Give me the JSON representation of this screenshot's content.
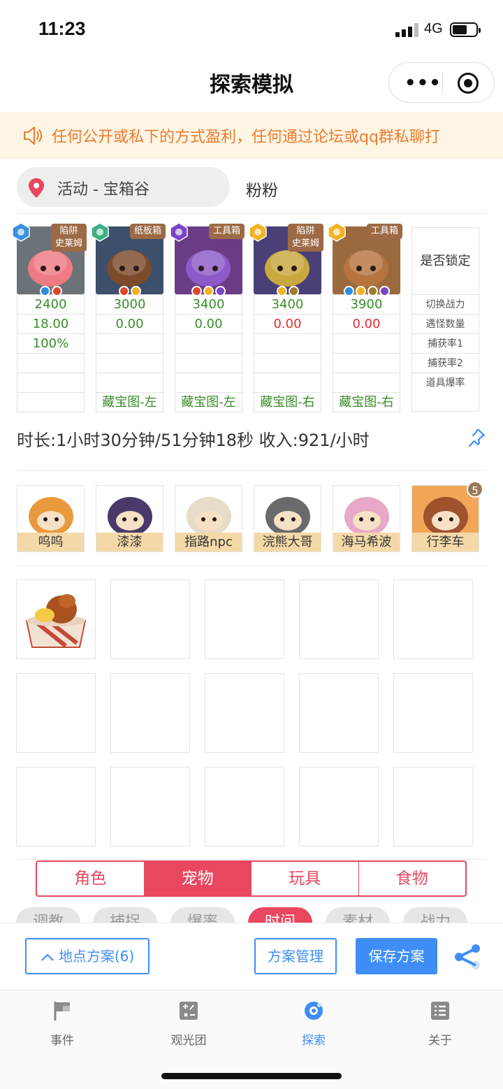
{
  "status_bar": {
    "time": "11:23",
    "network": "4G"
  },
  "nav": {
    "title": "探索模拟"
  },
  "notice": {
    "text": "任何公开或私下的方式盈利，任何通过论坛或qq群私聊打"
  },
  "location": {
    "label": "活动 - 宝箱谷",
    "user": "粉粉"
  },
  "pets": [
    {
      "tag": "陷阱\n史莱姆",
      "elem_color": "#3b8fe0",
      "bg": "#6b7278",
      "body": "#ee7b84",
      "minis": [
        "#2d8be0",
        "#e0452d"
      ],
      "cells": [
        {
          "v": "2400",
          "c": "g"
        },
        {
          "v": "18.00",
          "c": "g"
        },
        {
          "v": "100%",
          "c": "g"
        },
        {
          "v": "",
          "c": ""
        },
        {
          "v": "",
          "c": ""
        },
        {
          "v": "",
          "c": ""
        }
      ]
    },
    {
      "tag": "纸板箱",
      "elem_color": "#3cb084",
      "bg": "#3c4f6b",
      "body": "#7c4b2a",
      "minis": [
        "#e0452d",
        "#f2b223"
      ],
      "cells": [
        {
          "v": "3000",
          "c": "g"
        },
        {
          "v": "0.00",
          "c": "g"
        },
        {
          "v": "",
          "c": ""
        },
        {
          "v": "",
          "c": ""
        },
        {
          "v": "",
          "c": ""
        },
        {
          "v": "藏宝图-左",
          "c": "g"
        }
      ]
    },
    {
      "tag": "工具箱",
      "elem_color": "#7a45c8",
      "bg": "#6a3c86",
      "body": "#8c5bc9",
      "minis": [
        "#e0452d",
        "#f2b223",
        "#7a45c8"
      ],
      "cells": [
        {
          "v": "3400",
          "c": "g"
        },
        {
          "v": "0.00",
          "c": "g"
        },
        {
          "v": "",
          "c": ""
        },
        {
          "v": "",
          "c": ""
        },
        {
          "v": "",
          "c": ""
        },
        {
          "v": "藏宝图-左",
          "c": "g"
        }
      ]
    },
    {
      "tag": "陷阱\n史莱姆",
      "elem_color": "#f2b223",
      "bg": "#4a3f77",
      "body": "#c9a83e",
      "minis": [
        "#f2b223",
        "#9c7b2b"
      ],
      "cells": [
        {
          "v": "3400",
          "c": "g"
        },
        {
          "v": "0.00",
          "c": "r"
        },
        {
          "v": "",
          "c": ""
        },
        {
          "v": "",
          "c": ""
        },
        {
          "v": "",
          "c": ""
        },
        {
          "v": "藏宝图-右",
          "c": "g"
        }
      ]
    },
    {
      "tag": "工具箱",
      "elem_color": "#f2b223",
      "bg": "#9a6a3f",
      "body": "#b6743f",
      "minis": [
        "#2d8be0",
        "#f2b223",
        "#9c7b2b",
        "#7a45c8"
      ],
      "cells": [
        {
          "v": "3900",
          "c": "g"
        },
        {
          "v": "0.00",
          "c": "r"
        },
        {
          "v": "",
          "c": ""
        },
        {
          "v": "",
          "c": ""
        },
        {
          "v": "",
          "c": ""
        },
        {
          "v": "藏宝图-右",
          "c": "g"
        }
      ]
    }
  ],
  "lock_column": {
    "header": "是否锁定",
    "labels": [
      "切换战力",
      "遇怪数量",
      "捕获率1",
      "捕获率2",
      "道具爆率"
    ]
  },
  "summary": {
    "text": "时长:1小时30分钟/51分钟18秒 收入:921/小时"
  },
  "characters": [
    {
      "name": "呜呜",
      "color": "#e89a3c"
    },
    {
      "name": "漆漆",
      "color": "#4a3a6a"
    },
    {
      "name": "指路npc",
      "color": "#e7dcc8"
    },
    {
      "name": "浣熊大哥",
      "color": "#6a6a6a"
    },
    {
      "name": "海马希波",
      "color": "#e8a8c8"
    },
    {
      "name": "行李车",
      "color": "#a0522d"
    }
  ],
  "characters_badge": "5",
  "category_tabs": [
    {
      "label": "角色",
      "active": false
    },
    {
      "label": "宠物",
      "active": true
    },
    {
      "label": "玩具",
      "active": false
    },
    {
      "label": "食物",
      "active": false
    }
  ],
  "filter_chips": [
    {
      "label": "调教",
      "active": false
    },
    {
      "label": "捕捉",
      "active": false
    },
    {
      "label": "爆率",
      "active": false
    },
    {
      "label": "时间",
      "active": true
    },
    {
      "label": "素材",
      "active": false
    },
    {
      "label": "战力",
      "active": false
    }
  ],
  "actions": {
    "location_plan": "地点方案(6)",
    "manage": "方案管理",
    "save": "保存方案"
  },
  "tabbar": [
    {
      "label": "事件",
      "icon": "flag-icon",
      "active": false
    },
    {
      "label": "观光团",
      "icon": "calculator-icon",
      "active": false
    },
    {
      "label": "探索",
      "icon": "explore-icon",
      "active": true
    },
    {
      "label": "关于",
      "icon": "list-icon",
      "active": false
    }
  ],
  "colors": {
    "accent": "#e8475f",
    "primary": "#3f8ef5",
    "notice_text": "#ee7a2e",
    "value_green": "#3a8c2b",
    "value_red": "#e12f2f"
  }
}
